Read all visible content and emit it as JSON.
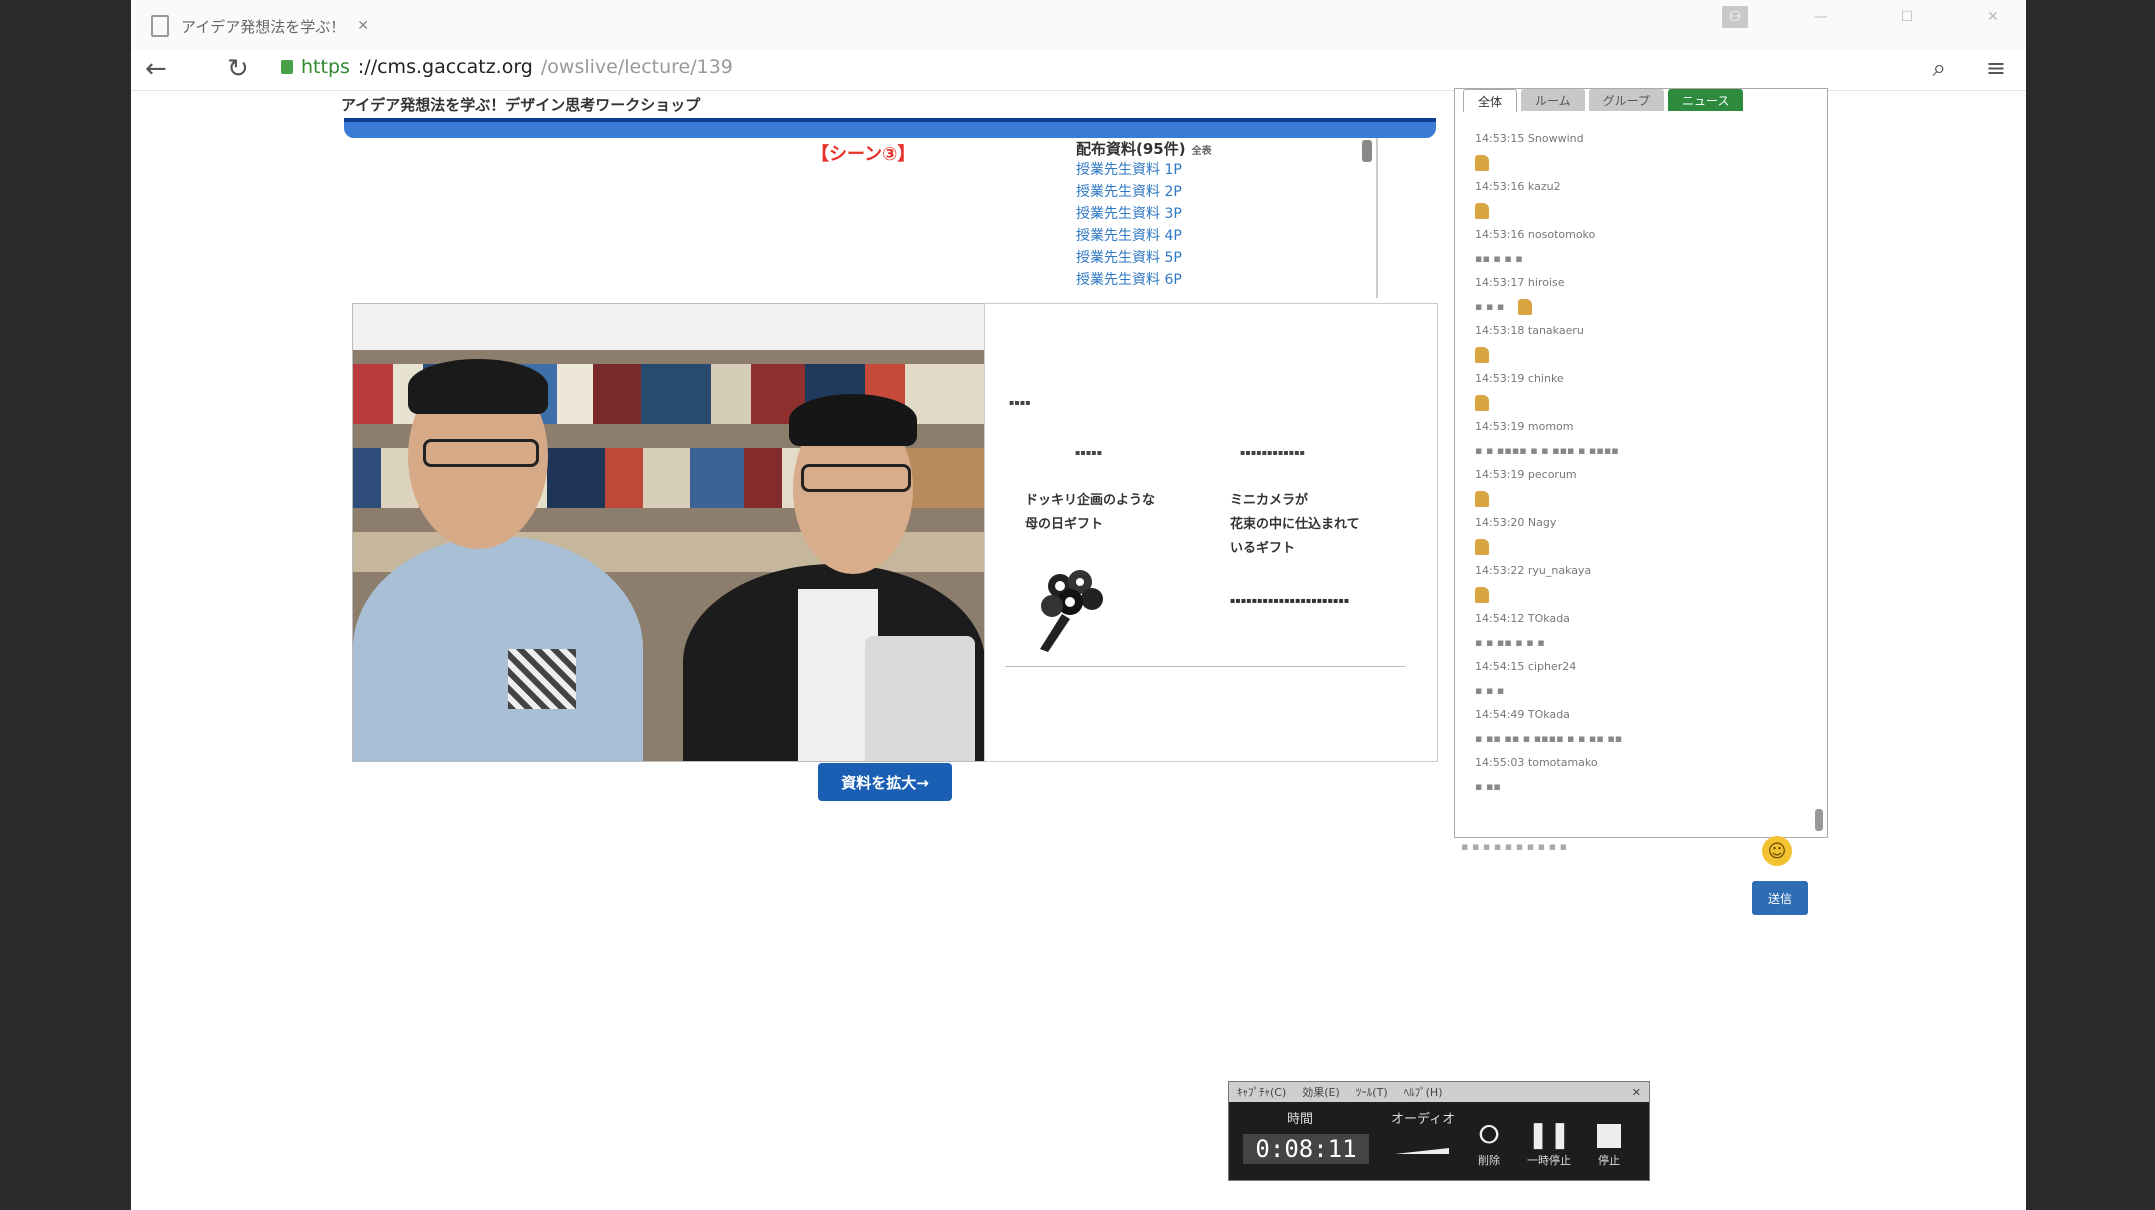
{
  "browser": {
    "tab_title": "アイデア発想法を学ぶ！",
    "tab_close": "✕",
    "url_scheme": "https",
    "url_host": "://cms.gaccatz.org",
    "url_path": "/owslive/lecture/139"
  },
  "page": {
    "course_title": "アイデア発想法を学ぶ！デザイン思考ワークショップ",
    "scene_label": "【シーン③】",
    "enlarge_button": "資料を拡大→"
  },
  "handouts": {
    "title": "配布資料(95件)",
    "title_suffix": "全表",
    "items": [
      "授業先生資料 1P",
      "授業先生資料 2P",
      "授業先生資料 3P",
      "授業先生資料 4P",
      "授業先生資料 5P",
      "授業先生資料 6P"
    ]
  },
  "slide": {
    "left_text_1": "ドッキリ企画のような",
    "left_text_2": "母の日ギフト",
    "right_text_1": "ミニカメラが",
    "right_text_2": "花束の中に仕込まれて",
    "right_text_3": "いるギフト"
  },
  "chat": {
    "tabs": [
      "全体",
      "ルーム",
      "グループ",
      "ニュース"
    ],
    "messages": [
      {
        "meta": "14:53:15 Snowwind"
      },
      {
        "meta": "14:53:16 kazu2"
      },
      {
        "meta": "14:53:16 nosotomoko"
      },
      {
        "meta": "14:53:17 hiroise"
      },
      {
        "meta": "14:53:18 tanakaeru"
      },
      {
        "meta": "14:53:19 chinke"
      },
      {
        "meta": "14:53:19 momom"
      },
      {
        "meta": "14:53:19 pecorum"
      },
      {
        "meta": "14:53:20 Nagy"
      },
      {
        "meta": "14:53:22 ryu_nakaya"
      },
      {
        "meta": "14:54:12 TOkada"
      },
      {
        "meta": "14:54:15 cipher24"
      },
      {
        "meta": "14:54:49 TOkada"
      },
      {
        "meta": "14:55:03 tomotamako"
      }
    ],
    "send_label": "送信"
  },
  "recorder": {
    "menu": [
      "ｷｬﾌﾟﾁｬ(C)",
      "効果(E)",
      "ﾂｰﾙ(T)",
      "ﾍﾙﾌﾟ(H)"
    ],
    "time_label": "時間",
    "time_value": "0:08:11",
    "audio_label": "オーディオ",
    "delete_label": "削除",
    "pause_label": "一時停止",
    "stop_label": "停止"
  }
}
